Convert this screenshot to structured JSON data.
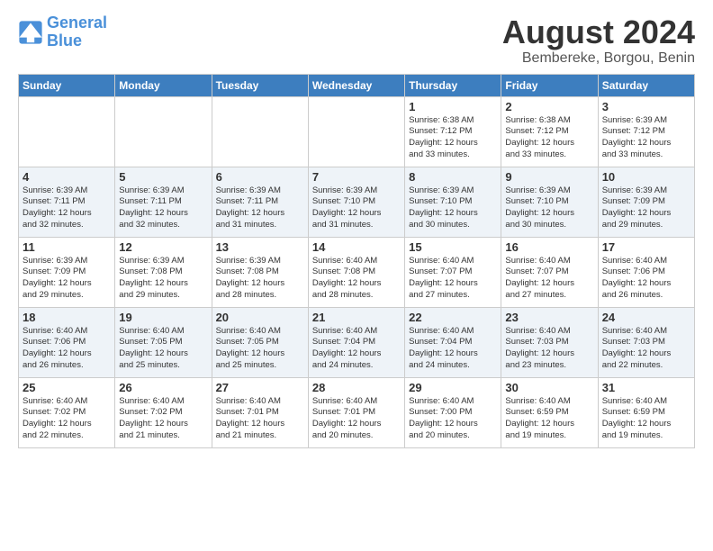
{
  "logo": {
    "line1": "General",
    "line2": "Blue"
  },
  "title": "August 2024",
  "subtitle": "Bembereke, Borgou, Benin",
  "headers": [
    "Sunday",
    "Monday",
    "Tuesday",
    "Wednesday",
    "Thursday",
    "Friday",
    "Saturday"
  ],
  "weeks": [
    [
      {
        "day": "",
        "info": ""
      },
      {
        "day": "",
        "info": ""
      },
      {
        "day": "",
        "info": ""
      },
      {
        "day": "",
        "info": ""
      },
      {
        "day": "1",
        "info": "Sunrise: 6:38 AM\nSunset: 7:12 PM\nDaylight: 12 hours\nand 33 minutes."
      },
      {
        "day": "2",
        "info": "Sunrise: 6:38 AM\nSunset: 7:12 PM\nDaylight: 12 hours\nand 33 minutes."
      },
      {
        "day": "3",
        "info": "Sunrise: 6:39 AM\nSunset: 7:12 PM\nDaylight: 12 hours\nand 33 minutes."
      }
    ],
    [
      {
        "day": "4",
        "info": "Sunrise: 6:39 AM\nSunset: 7:11 PM\nDaylight: 12 hours\nand 32 minutes."
      },
      {
        "day": "5",
        "info": "Sunrise: 6:39 AM\nSunset: 7:11 PM\nDaylight: 12 hours\nand 32 minutes."
      },
      {
        "day": "6",
        "info": "Sunrise: 6:39 AM\nSunset: 7:11 PM\nDaylight: 12 hours\nand 31 minutes."
      },
      {
        "day": "7",
        "info": "Sunrise: 6:39 AM\nSunset: 7:10 PM\nDaylight: 12 hours\nand 31 minutes."
      },
      {
        "day": "8",
        "info": "Sunrise: 6:39 AM\nSunset: 7:10 PM\nDaylight: 12 hours\nand 30 minutes."
      },
      {
        "day": "9",
        "info": "Sunrise: 6:39 AM\nSunset: 7:10 PM\nDaylight: 12 hours\nand 30 minutes."
      },
      {
        "day": "10",
        "info": "Sunrise: 6:39 AM\nSunset: 7:09 PM\nDaylight: 12 hours\nand 29 minutes."
      }
    ],
    [
      {
        "day": "11",
        "info": "Sunrise: 6:39 AM\nSunset: 7:09 PM\nDaylight: 12 hours\nand 29 minutes."
      },
      {
        "day": "12",
        "info": "Sunrise: 6:39 AM\nSunset: 7:08 PM\nDaylight: 12 hours\nand 29 minutes."
      },
      {
        "day": "13",
        "info": "Sunrise: 6:39 AM\nSunset: 7:08 PM\nDaylight: 12 hours\nand 28 minutes."
      },
      {
        "day": "14",
        "info": "Sunrise: 6:40 AM\nSunset: 7:08 PM\nDaylight: 12 hours\nand 28 minutes."
      },
      {
        "day": "15",
        "info": "Sunrise: 6:40 AM\nSunset: 7:07 PM\nDaylight: 12 hours\nand 27 minutes."
      },
      {
        "day": "16",
        "info": "Sunrise: 6:40 AM\nSunset: 7:07 PM\nDaylight: 12 hours\nand 27 minutes."
      },
      {
        "day": "17",
        "info": "Sunrise: 6:40 AM\nSunset: 7:06 PM\nDaylight: 12 hours\nand 26 minutes."
      }
    ],
    [
      {
        "day": "18",
        "info": "Sunrise: 6:40 AM\nSunset: 7:06 PM\nDaylight: 12 hours\nand 26 minutes."
      },
      {
        "day": "19",
        "info": "Sunrise: 6:40 AM\nSunset: 7:05 PM\nDaylight: 12 hours\nand 25 minutes."
      },
      {
        "day": "20",
        "info": "Sunrise: 6:40 AM\nSunset: 7:05 PM\nDaylight: 12 hours\nand 25 minutes."
      },
      {
        "day": "21",
        "info": "Sunrise: 6:40 AM\nSunset: 7:04 PM\nDaylight: 12 hours\nand 24 minutes."
      },
      {
        "day": "22",
        "info": "Sunrise: 6:40 AM\nSunset: 7:04 PM\nDaylight: 12 hours\nand 24 minutes."
      },
      {
        "day": "23",
        "info": "Sunrise: 6:40 AM\nSunset: 7:03 PM\nDaylight: 12 hours\nand 23 minutes."
      },
      {
        "day": "24",
        "info": "Sunrise: 6:40 AM\nSunset: 7:03 PM\nDaylight: 12 hours\nand 22 minutes."
      }
    ],
    [
      {
        "day": "25",
        "info": "Sunrise: 6:40 AM\nSunset: 7:02 PM\nDaylight: 12 hours\nand 22 minutes."
      },
      {
        "day": "26",
        "info": "Sunrise: 6:40 AM\nSunset: 7:02 PM\nDaylight: 12 hours\nand 21 minutes."
      },
      {
        "day": "27",
        "info": "Sunrise: 6:40 AM\nSunset: 7:01 PM\nDaylight: 12 hours\nand 21 minutes."
      },
      {
        "day": "28",
        "info": "Sunrise: 6:40 AM\nSunset: 7:01 PM\nDaylight: 12 hours\nand 20 minutes."
      },
      {
        "day": "29",
        "info": "Sunrise: 6:40 AM\nSunset: 7:00 PM\nDaylight: 12 hours\nand 20 minutes."
      },
      {
        "day": "30",
        "info": "Sunrise: 6:40 AM\nSunset: 6:59 PM\nDaylight: 12 hours\nand 19 minutes."
      },
      {
        "day": "31",
        "info": "Sunrise: 6:40 AM\nSunset: 6:59 PM\nDaylight: 12 hours\nand 19 minutes."
      }
    ]
  ]
}
